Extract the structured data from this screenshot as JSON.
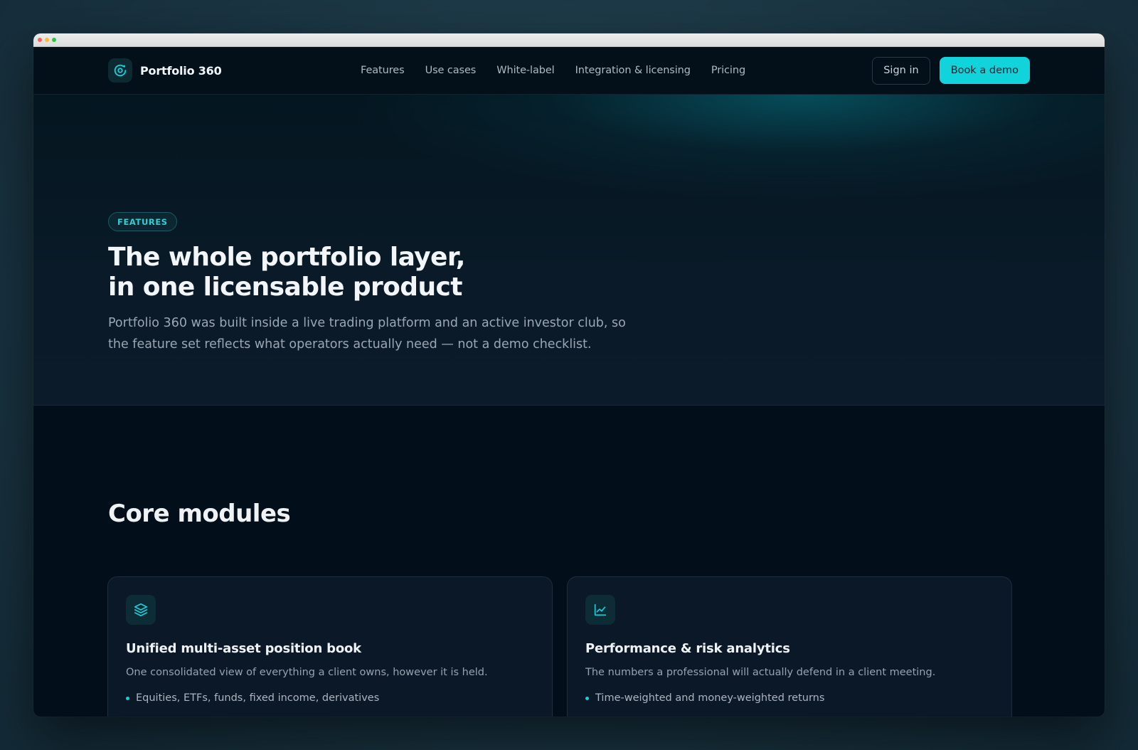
{
  "brand": {
    "name": "Portfolio 360",
    "icon": "orbit-logo-icon",
    "accent": "#10d3dc"
  },
  "nav": {
    "links": [
      "Features",
      "Use cases",
      "White-label",
      "Integration & licensing",
      "Pricing"
    ],
    "sign_in": "Sign in",
    "book_demo": "Book a demo"
  },
  "hero": {
    "tag": "FEATURES",
    "title_line1": "The whole portfolio layer,",
    "title_line2": "in one licensable product",
    "subtitle": "Portfolio 360 was built inside a live trading platform and an active investor club, so the feature set reflects what operators actually need — not a demo checklist."
  },
  "modules": {
    "title": "Core modules",
    "cards": [
      {
        "icon": "layers-icon",
        "title": "Unified multi-asset position book",
        "description": "One consolidated view of everything a client owns, however it is held.",
        "bullets": [
          "Equities, ETFs, funds, fixed income, derivatives"
        ]
      },
      {
        "icon": "line-chart-icon",
        "title": "Performance & risk analytics",
        "description": "The numbers a professional will actually defend in a client meeting.",
        "bullets": [
          "Time-weighted and money-weighted returns"
        ]
      }
    ]
  }
}
